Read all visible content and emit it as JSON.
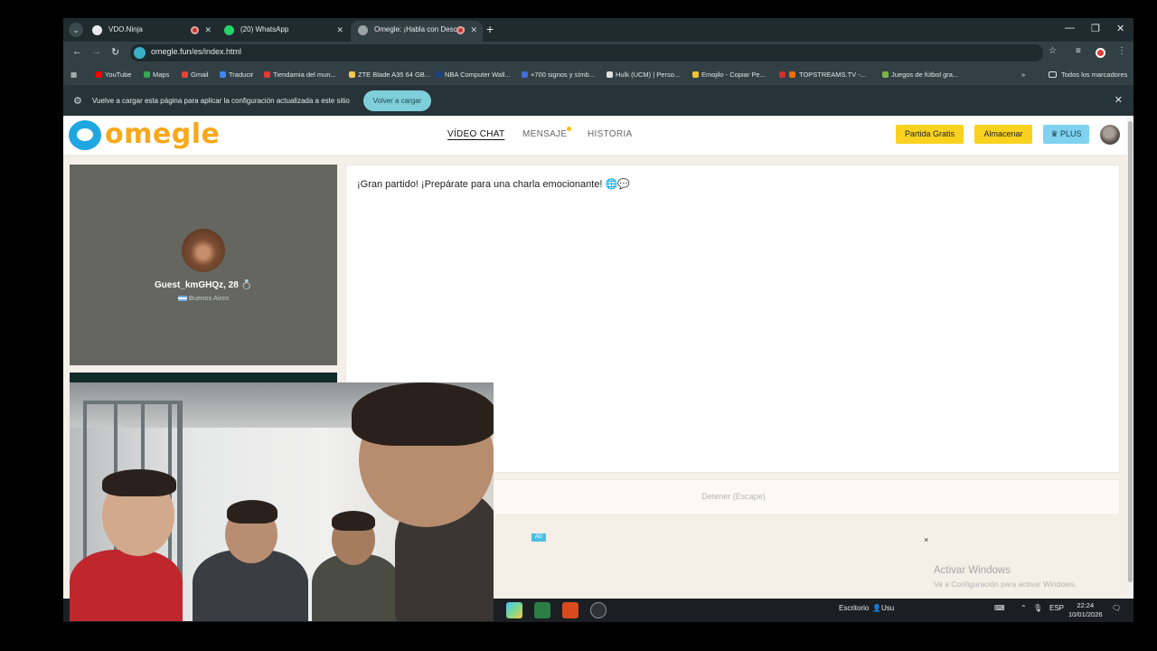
{
  "browser": {
    "tabs": [
      {
        "label": "VDO.Ninja",
        "active": false,
        "recording": true
      },
      {
        "label": "(20) WhatsApp",
        "active": false,
        "recording": false
      },
      {
        "label": "Omegle: ¡Habla con Descon",
        "active": true,
        "recording": true
      }
    ],
    "url": "omegle.fun/es/index.html",
    "bookmarks": [
      {
        "label": "YouTube",
        "color": "#ff0000"
      },
      {
        "label": "Maps",
        "color": "#34a853"
      },
      {
        "label": "Gmail",
        "color": "#ea4335"
      },
      {
        "label": "Traducir",
        "color": "#4285f4"
      },
      {
        "label": "Tiendamia del mun...",
        "color": "#e53935"
      },
      {
        "label": "ZTE Blade A35 64 GB...",
        "color": "#f2c94c"
      },
      {
        "label": "NBA Computer Wall...",
        "color": "#1d428a"
      },
      {
        "label": "+700 signos y símb...",
        "color": "#3f6fd8"
      },
      {
        "label": "Hulk (UCM) | Perso...",
        "color": "#e0e0e0"
      },
      {
        "label": "Emojilo - Copiar Pe...",
        "color": "#f4c430"
      },
      {
        "label": "TOPSTREAMS.TV -...",
        "color": "#d32f2f"
      },
      {
        "label": "Juegos de fútbol gra...",
        "color": "#7cb342"
      }
    ],
    "bookmarks_more": "»",
    "all_bookmarks": "Todos los marcadores",
    "infobar_text": "Vuelve a cargar esta página para aplicar la configuración actualizada a este sitio",
    "infobar_button": "Volver a cargar"
  },
  "site": {
    "logo_text": "omegle",
    "nav": {
      "video_chat": "VÍDEO CHAT",
      "message": "MENSAJE",
      "history": "HISTORIA"
    },
    "buttons": {
      "free_match": "Partida Gratis",
      "store": "Almacenar",
      "plus": "PLUS",
      "plus_icon": "♛"
    },
    "peer": {
      "name": "Guest_kmGHQz, 28 💍",
      "location": "Buenos Aires"
    },
    "chat_message": "¡Gran partido! ¡Prepárate para una charla emocionante! 🌐💬",
    "stop_button": "Detener (Escape)",
    "ad_badge": "AD",
    "ad_close": "×"
  },
  "windows": {
    "activation_title": "Activar Windows",
    "activation_subtitle": "Ve a Configuración para activar Windows.",
    "taskbar": {
      "desktop_label": "Escritorio",
      "user_label": "Usu",
      "language": "ESP",
      "time": "22:24",
      "date": "10/01/2026"
    }
  }
}
